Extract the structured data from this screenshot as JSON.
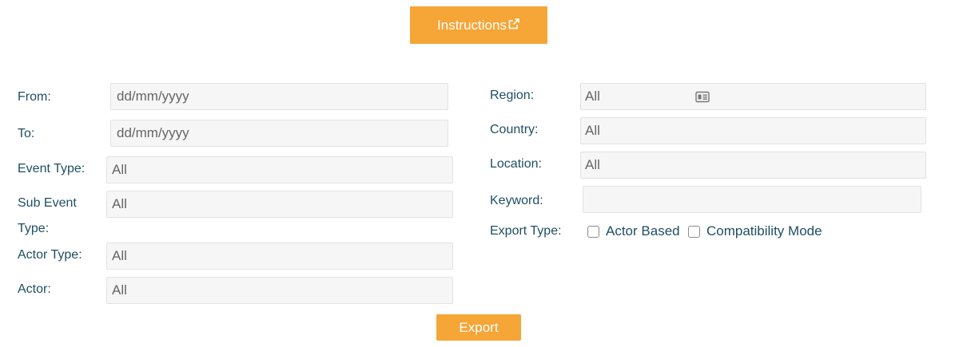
{
  "header": {
    "instructions_label": "Instructions",
    "external_link_icon": "external-link-icon"
  },
  "left": {
    "from": {
      "label": "From:",
      "placeholder": "dd/mm/yyyy"
    },
    "to": {
      "label": "To:",
      "placeholder": "dd/mm/yyyy"
    },
    "event_type": {
      "label": "Event Type:",
      "value": "All"
    },
    "sub_event_type": {
      "label_line1": "Sub Event",
      "label_line2": "Type:",
      "value": "All"
    },
    "actor_type": {
      "label": "Actor Type:",
      "value": "All"
    },
    "actor": {
      "label": "Actor:",
      "value": "All"
    }
  },
  "right": {
    "region": {
      "label": "Region:",
      "value": "All",
      "icon": "id-card-icon"
    },
    "country": {
      "label": "Country:",
      "value": "All"
    },
    "location": {
      "label": "Location:",
      "value": "All"
    },
    "keyword": {
      "label": "Keyword:",
      "value": ""
    },
    "export_type": {
      "label": "Export Type:",
      "options": [
        {
          "label": "Actor Based",
          "checked": false
        },
        {
          "label": "Compatibility Mode",
          "checked": false
        }
      ]
    }
  },
  "footer": {
    "export_label": "Export"
  },
  "colors": {
    "accent": "#f6a537",
    "label": "#1f4e63",
    "field_bg": "#f6f6f6"
  }
}
